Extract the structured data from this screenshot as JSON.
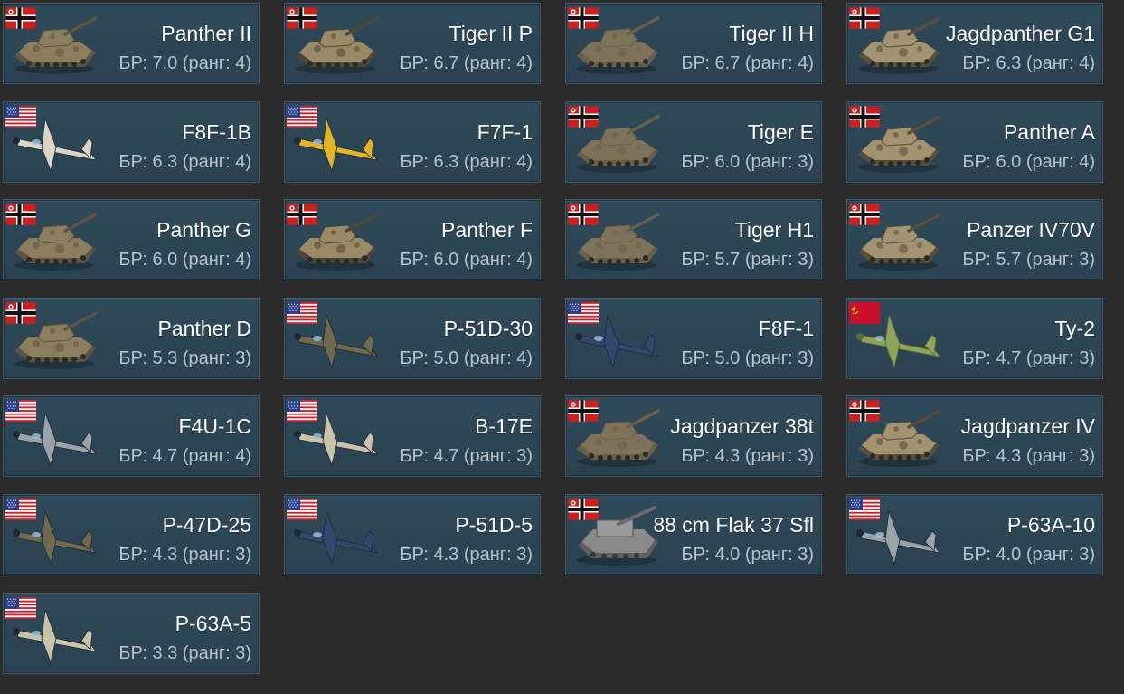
{
  "br_prefix": "БР:",
  "rank_word": "ранг:",
  "vehicles": [
    {
      "name": "Panther II",
      "br": "7.0",
      "rank": "4",
      "nation": "germany",
      "kind": "tank",
      "br_text": "БР: 7.0 (ранг: 4)"
    },
    {
      "name": "Tiger II P",
      "br": "6.7",
      "rank": "4",
      "nation": "germany",
      "kind": "tank",
      "br_text": "БР: 6.7 (ранг: 4)"
    },
    {
      "name": "Tiger II H",
      "br": "6.7",
      "rank": "4",
      "nation": "germany",
      "kind": "tank",
      "br_text": "БР: 6.7 (ранг: 4)"
    },
    {
      "name": "Jagdpanther G1",
      "br": "6.3",
      "rank": "4",
      "nation": "germany",
      "kind": "tank",
      "br_text": "БР: 6.3 (ранг: 4)"
    },
    {
      "name": "F8F-1B",
      "br": "6.3",
      "rank": "4",
      "nation": "usa",
      "kind": "plane",
      "br_text": "БР: 6.3 (ранг: 4)"
    },
    {
      "name": "F7F-1",
      "br": "6.3",
      "rank": "4",
      "nation": "usa",
      "kind": "plane",
      "br_text": "БР: 6.3 (ранг: 4)"
    },
    {
      "name": "Tiger E",
      "br": "6.0",
      "rank": "3",
      "nation": "germany",
      "kind": "tank",
      "br_text": "БР: 6.0 (ранг: 3)"
    },
    {
      "name": "Panther A",
      "br": "6.0",
      "rank": "4",
      "nation": "germany",
      "kind": "tank",
      "br_text": "БР: 6.0 (ранг: 4)"
    },
    {
      "name": "Panther G",
      "br": "6.0",
      "rank": "4",
      "nation": "germany",
      "kind": "tank",
      "br_text": "БР: 6.0 (ранг: 4)"
    },
    {
      "name": "Panther F",
      "br": "6.0",
      "rank": "4",
      "nation": "germany",
      "kind": "tank",
      "br_text": "БР: 6.0 (ранг: 4)"
    },
    {
      "name": "Tiger H1",
      "br": "5.7",
      "rank": "3",
      "nation": "germany",
      "kind": "tank",
      "br_text": "БР: 5.7 (ранг: 3)"
    },
    {
      "name": "Panzer IV70V",
      "br": "5.7",
      "rank": "3",
      "nation": "germany",
      "kind": "tank",
      "br_text": "БР: 5.7 (ранг: 3)"
    },
    {
      "name": "Panther D",
      "br": "5.3",
      "rank": "3",
      "nation": "germany",
      "kind": "tank",
      "br_text": "БР: 5.3 (ранг: 3)"
    },
    {
      "name": "P-51D-30",
      "br": "5.0",
      "rank": "4",
      "nation": "usa",
      "kind": "plane",
      "br_text": "БР: 5.0 (ранг: 4)"
    },
    {
      "name": "F8F-1",
      "br": "5.0",
      "rank": "3",
      "nation": "usa",
      "kind": "plane",
      "br_text": "БР: 5.0 (ранг: 3)"
    },
    {
      "name": "Ту-2",
      "br": "4.7",
      "rank": "3",
      "nation": "ussr",
      "kind": "plane",
      "br_text": "БР: 4.7 (ранг: 3)"
    },
    {
      "name": "F4U-1C",
      "br": "4.7",
      "rank": "4",
      "nation": "usa",
      "kind": "plane",
      "br_text": "БР: 4.7 (ранг: 4)"
    },
    {
      "name": "B-17E",
      "br": "4.7",
      "rank": "3",
      "nation": "usa",
      "kind": "plane",
      "br_text": "БР: 4.7 (ранг: 3)"
    },
    {
      "name": "Jagdpanzer 38t",
      "br": "4.3",
      "rank": "3",
      "nation": "germany",
      "kind": "tank",
      "br_text": "БР: 4.3 (ранг: 3)"
    },
    {
      "name": "Jagdpanzer IV",
      "br": "4.3",
      "rank": "3",
      "nation": "germany",
      "kind": "tank",
      "br_text": "БР: 4.3 (ранг: 3)"
    },
    {
      "name": "P-47D-25",
      "br": "4.3",
      "rank": "3",
      "nation": "usa",
      "kind": "plane",
      "br_text": "БР: 4.3 (ранг: 3)"
    },
    {
      "name": "P-51D-5",
      "br": "4.3",
      "rank": "3",
      "nation": "usa",
      "kind": "plane",
      "br_text": "БР: 4.3 (ранг: 3)"
    },
    {
      "name": "88 cm Flak 37 Sfl",
      "br": "4.0",
      "rank": "3",
      "nation": "germany",
      "kind": "spaa",
      "br_text": "БР: 4.0 (ранг: 3)"
    },
    {
      "name": "P-63A-10",
      "br": "4.0",
      "rank": "3",
      "nation": "usa",
      "kind": "plane",
      "br_text": "БР: 4.0 (ранг: 3)"
    },
    {
      "name": "P-63A-5",
      "br": "3.3",
      "rank": "3",
      "nation": "usa",
      "kind": "plane",
      "br_text": "БР: 3.3 (ранг: 3)"
    }
  ],
  "colors": {
    "page_bg": "#2b2b2b",
    "card_bg": "#2f4a5a",
    "card_border": "#3e5a6b",
    "name_text": "#ffffff",
    "br_text": "#b7c2c9"
  }
}
